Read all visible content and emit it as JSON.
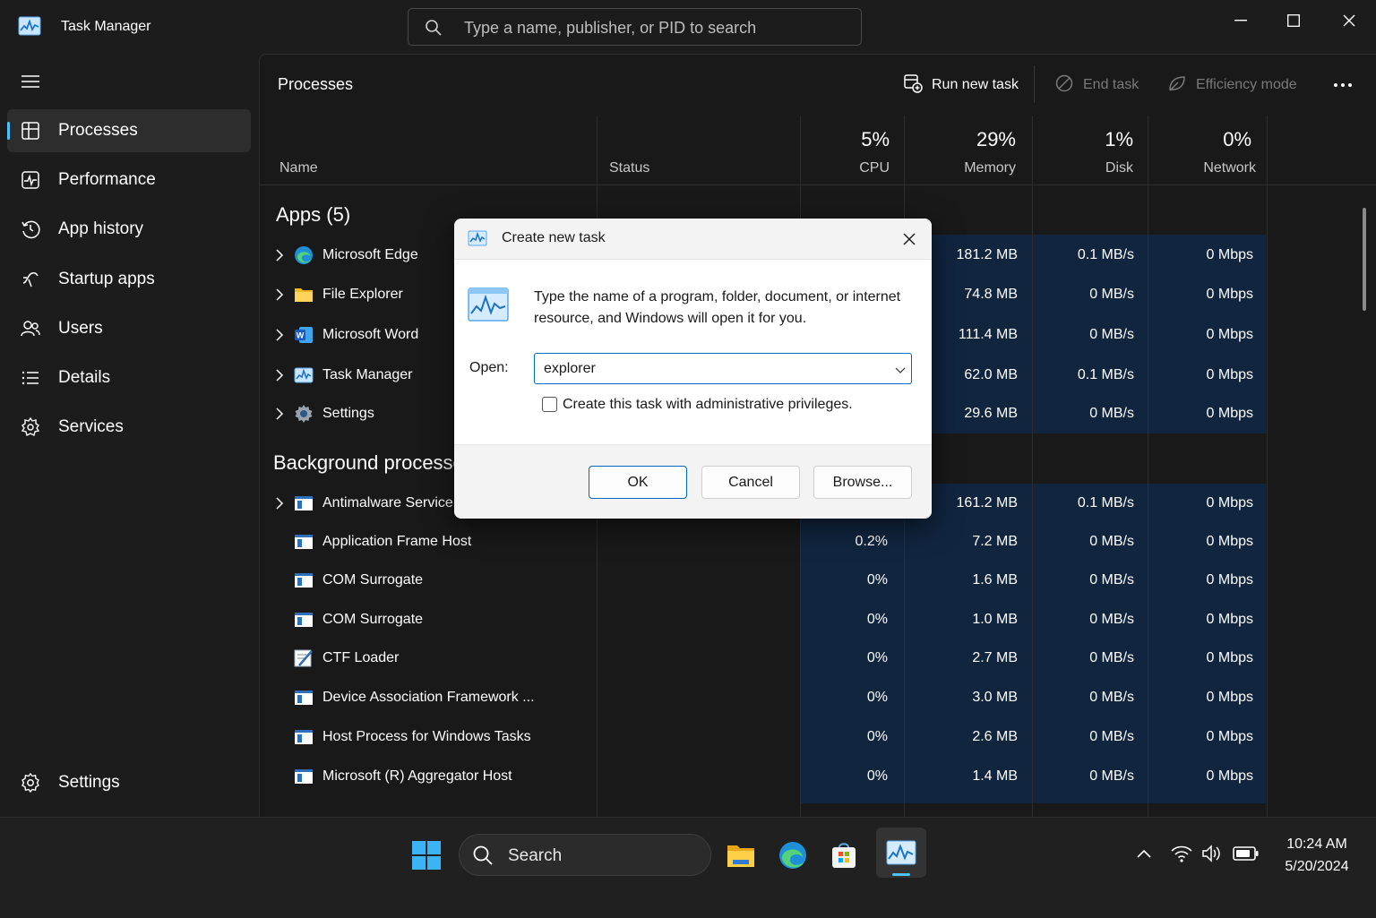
{
  "window": {
    "title": "Task Manager",
    "search_placeholder": "Type a name, publisher, or PID to search"
  },
  "sidebar": {
    "items": [
      {
        "label": "Processes",
        "icon": "processes-icon",
        "active": true
      },
      {
        "label": "Performance",
        "icon": "performance-icon"
      },
      {
        "label": "App history",
        "icon": "app-history-icon"
      },
      {
        "label": "Startup apps",
        "icon": "startup-apps-icon"
      },
      {
        "label": "Users",
        "icon": "users-icon"
      },
      {
        "label": "Details",
        "icon": "details-icon"
      },
      {
        "label": "Services",
        "icon": "services-icon"
      }
    ],
    "settings_label": "Settings"
  },
  "toolbar": {
    "page_title": "Processes",
    "run_new_task": "Run new task",
    "end_task": "End task",
    "efficiency_mode": "Efficiency mode"
  },
  "columns": {
    "name": "Name",
    "status": "Status",
    "cpu": {
      "pct": "5%",
      "label": "CPU"
    },
    "memory": {
      "pct": "29%",
      "label": "Memory"
    },
    "disk": {
      "pct": "1%",
      "label": "Disk"
    },
    "network": {
      "pct": "0%",
      "label": "Network"
    }
  },
  "groups": {
    "apps_title": "Apps (5)",
    "background_title": "Background processes (",
    "apps": [
      {
        "name": "Microsoft Edge",
        "icon": "edge-icon",
        "memory": "181.2 MB",
        "disk": "0.1 MB/s",
        "network": "0 Mbps"
      },
      {
        "name": "File Explorer",
        "icon": "folder-icon",
        "memory": "74.8 MB",
        "disk": "0 MB/s",
        "network": "0 Mbps"
      },
      {
        "name": "Microsoft Word",
        "icon": "word-icon",
        "memory": "111.4 MB",
        "disk": "0 MB/s",
        "network": "0 Mbps"
      },
      {
        "name": "Task Manager",
        "icon": "task-manager-icon",
        "memory": "62.0 MB",
        "disk": "0.1 MB/s",
        "network": "0 Mbps"
      },
      {
        "name": "Settings",
        "icon": "settings-gear-icon",
        "memory": "29.6 MB",
        "disk": "0 MB/s",
        "network": "0 Mbps"
      }
    ],
    "background": [
      {
        "name": "Antimalware Service Exe",
        "expandable": true,
        "cpu": "",
        "memory": "161.2 MB",
        "disk": "0.1 MB/s",
        "network": "0 Mbps"
      },
      {
        "name": "Application Frame Host",
        "cpu": "0.2%",
        "memory": "7.2 MB",
        "disk": "0 MB/s",
        "network": "0 Mbps"
      },
      {
        "name": "COM Surrogate",
        "cpu": "0%",
        "memory": "1.6 MB",
        "disk": "0 MB/s",
        "network": "0 Mbps"
      },
      {
        "name": "COM Surrogate",
        "cpu": "0%",
        "memory": "1.0 MB",
        "disk": "0 MB/s",
        "network": "0 Mbps"
      },
      {
        "name": "CTF Loader",
        "cpu": "0%",
        "memory": "2.7 MB",
        "disk": "0 MB/s",
        "network": "0 Mbps"
      },
      {
        "name": "Device Association Framework ...",
        "cpu": "0%",
        "memory": "3.0 MB",
        "disk": "0 MB/s",
        "network": "0 Mbps"
      },
      {
        "name": "Host Process for Windows Tasks",
        "cpu": "0%",
        "memory": "2.6 MB",
        "disk": "0 MB/s",
        "network": "0 Mbps"
      },
      {
        "name": "Microsoft (R) Aggregator Host",
        "cpu": "0%",
        "memory": "1.4 MB",
        "disk": "0 MB/s",
        "network": "0 Mbps"
      }
    ]
  },
  "dialog": {
    "title": "Create new task",
    "description": "Type the name of a program, folder, document, or internet resource, and Windows will open it for you.",
    "open_label": "Open:",
    "open_value": "explorer",
    "admin_checkbox_label": "Create this task with administrative privileges.",
    "admin_checked": false,
    "ok": "OK",
    "cancel": "Cancel",
    "browse": "Browse..."
  },
  "taskbar": {
    "search_label": "Search",
    "time": "10:24 AM",
    "date": "5/20/2024"
  },
  "colors": {
    "accent": "#4cc2ff",
    "heat": "#11253f",
    "dialog_primary": "#0067c0"
  }
}
